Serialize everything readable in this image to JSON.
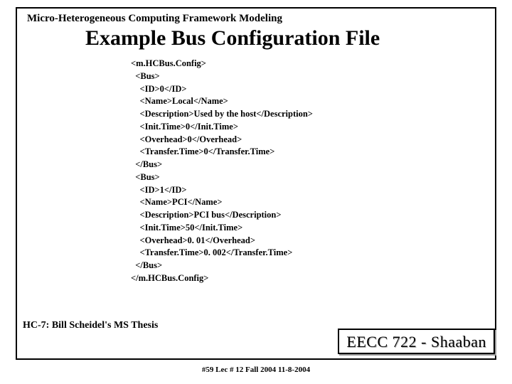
{
  "header": "Micro-Heterogeneous Computing Framework Modeling",
  "title": "Example Bus Configuration File",
  "code": "<m.HCBus.Config>\n  <Bus>\n    <ID>0</ID>\n    <Name>Local</Name>\n    <Description>Used by the host</Description>\n    <Init.Time>0</Init.Time>\n    <Overhead>0</Overhead>\n    <Transfer.Time>0</Transfer.Time>\n  </Bus>\n  <Bus>\n    <ID>1</ID>\n    <Name>PCI</Name>\n    <Description>PCI bus</Description>\n    <Init.Time>50</Init.Time>\n    <Overhead>0. 01</Overhead>\n    <Transfer.Time>0. 002</Transfer.Time>\n  </Bus>\n</m.HCBus.Config>",
  "thesis": "HC-7: Bill Scheidel's MS Thesis",
  "course": "EECC 722 - Shaaban",
  "footer": "#59   Lec # 12   Fall 2004  11-8-2004"
}
